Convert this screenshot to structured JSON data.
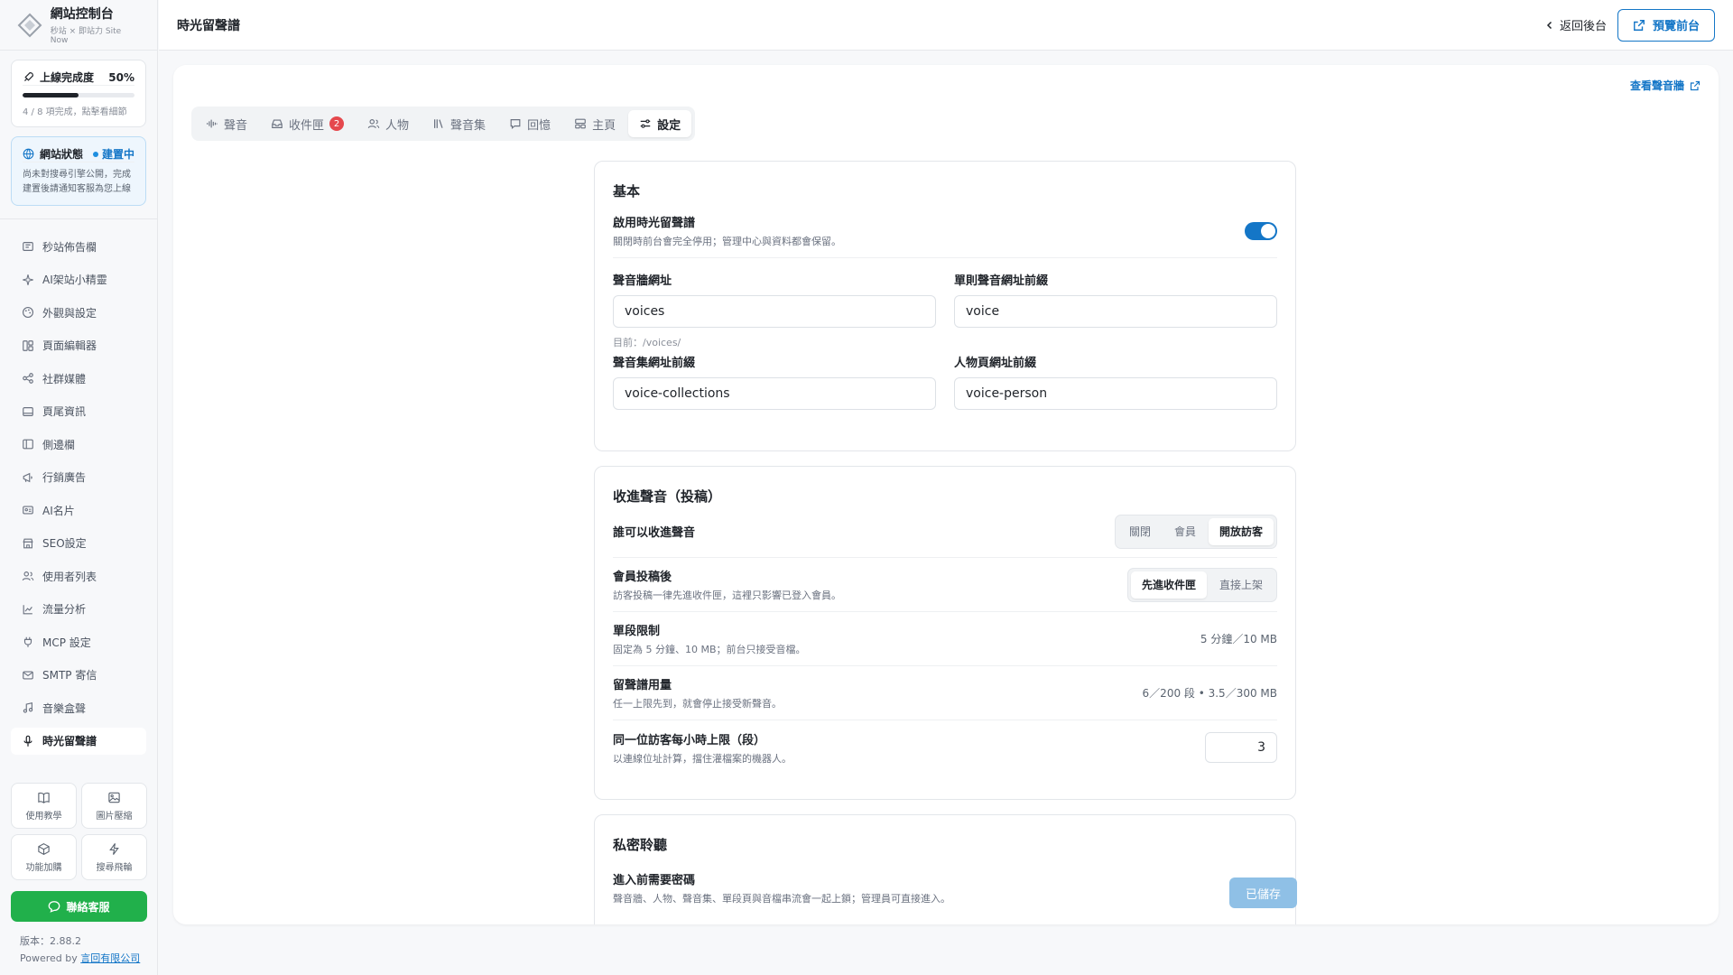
{
  "brand": {
    "title": "網站控制台",
    "subtitle": "秒站 × 即站力 Site Now"
  },
  "progress": {
    "label": "上線完成度",
    "percent_text": "50%",
    "fraction": 0.5,
    "hint": "4 / 8 項完成，點擊看細節"
  },
  "site_status": {
    "label": "網站狀態",
    "badge": "建置中",
    "desc": "尚未對搜尋引擎公開，完成建置後請通知客服為您上線"
  },
  "nav": [
    {
      "label": "秒站佈告欄",
      "icon": "bulletin-icon"
    },
    {
      "label": "AI架站小精靈",
      "icon": "sparkle-icon"
    },
    {
      "label": "外觀與設定",
      "icon": "palette-icon"
    },
    {
      "label": "頁面編輯器",
      "icon": "layout-icon"
    },
    {
      "label": "社群媒體",
      "icon": "share-icon"
    },
    {
      "label": "頁尾資訊",
      "icon": "footer-icon"
    },
    {
      "label": "側邊欄",
      "icon": "sidebar-icon"
    },
    {
      "label": "行銷廣告",
      "icon": "megaphone-icon"
    },
    {
      "label": "AI名片",
      "icon": "card-icon"
    },
    {
      "label": "SEO設定",
      "icon": "store-icon"
    },
    {
      "label": "使用者列表",
      "icon": "users-icon"
    },
    {
      "label": "流量分析",
      "icon": "chart-icon"
    },
    {
      "label": "MCP 設定",
      "icon": "plug-icon"
    },
    {
      "label": "SMTP 寄信",
      "icon": "mail-icon"
    },
    {
      "label": "音樂盒聲",
      "icon": "music-icon"
    },
    {
      "label": "時光留聲譜",
      "icon": "mic-icon"
    }
  ],
  "tools": [
    {
      "label": "使用教學",
      "icon": "book-icon"
    },
    {
      "label": "圖片壓縮",
      "icon": "image-icon"
    },
    {
      "label": "功能加購",
      "icon": "box-icon"
    },
    {
      "label": "搜尋飛輪",
      "icon": "bolt-icon"
    }
  ],
  "contact": "聯絡客服",
  "version": {
    "text": "版本：2.88.2",
    "powered": "Powered by",
    "company": "言回有限公司"
  },
  "header": {
    "title": "時光留聲譜",
    "back": "返回後台",
    "preview": "預覽前台"
  },
  "view_wall": "查看聲音牆",
  "tabs": [
    {
      "label": "聲音",
      "icon": "waveform-icon"
    },
    {
      "label": "收件匣",
      "icon": "inbox-icon",
      "badge": "2"
    },
    {
      "label": "人物",
      "icon": "people-icon"
    },
    {
      "label": "聲音集",
      "icon": "library-icon"
    },
    {
      "label": "回憶",
      "icon": "chat-icon"
    },
    {
      "label": "主頁",
      "icon": "home-layout-icon"
    },
    {
      "label": "設定",
      "icon": "sliders-icon",
      "active": true
    }
  ],
  "basic": {
    "title": "基本",
    "enable_label": "啟用時光留聲譜",
    "enable_desc": "關閉時前台會完全停用；管理中心與資料都會保留。",
    "enabled": true,
    "wall_url_label": "聲音牆網址",
    "wall_url": "voices",
    "wall_url_help": "目前：/voices/",
    "single_prefix_label": "單則聲音網址前綴",
    "single_prefix": "voice",
    "collection_prefix_label": "聲音集網址前綴",
    "collection_prefix": "voice-collections",
    "person_prefix_label": "人物頁網址前綴",
    "person_prefix": "voice-person"
  },
  "submission": {
    "title": "收進聲音（投稿）",
    "who_label": "誰可以收進聲音",
    "who_options": [
      "關閉",
      "會員",
      "開放訪客"
    ],
    "who_selected": "開放訪客",
    "after_label": "會員投稿後",
    "after_desc": "訪客投稿一律先進收件匣，這裡只影響已登入會員。",
    "after_options": [
      "先進收件匣",
      "直接上架"
    ],
    "after_selected": "先進收件匣",
    "limit_label": "單段限制",
    "limit_desc": "固定為 5 分鐘、10 MB；前台只接受音檔。",
    "limit_value": "5 分鐘／10 MB",
    "usage_label": "留聲譜用量",
    "usage_desc": "任一上限先到，就會停止接受新聲音。",
    "usage_value": "6／200 段 • 3.5／300 MB",
    "hourly_label": "同一位訪客每小時上限（段）",
    "hourly_desc": "以連線位址計算，擋住灌檔案的機器人。",
    "hourly_value": "3"
  },
  "private": {
    "title": "私密聆聽",
    "pwd_label": "進入前需要密碼",
    "pwd_desc": "聲音牆、人物、聲音集、單段頁與音檔串流會一起上鎖；管理員可直接進入。"
  },
  "save_button": "已儲存",
  "colors": {
    "accent": "#1476c7",
    "contact": "#21b04b",
    "badge": "#e5484d"
  }
}
